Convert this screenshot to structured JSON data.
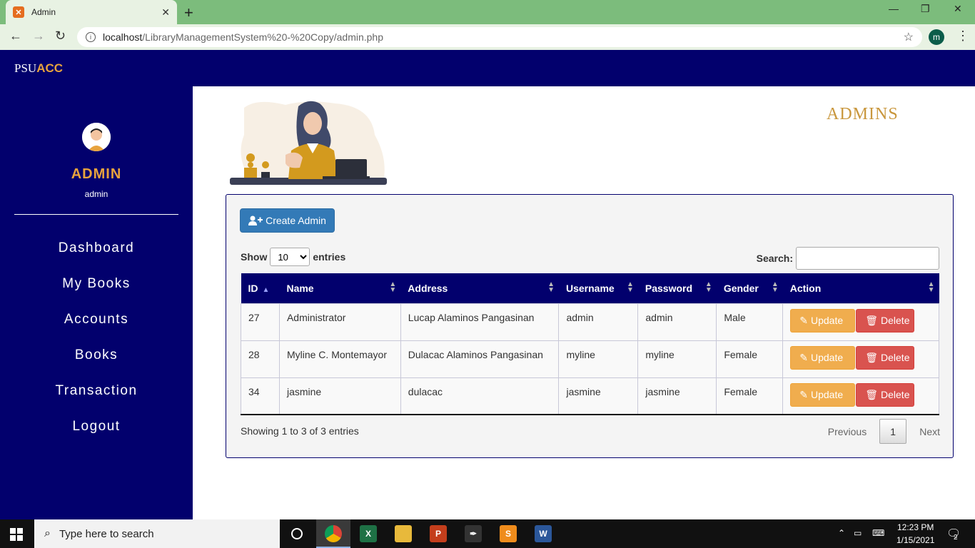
{
  "browser": {
    "tab_title": "Admin",
    "url_host": "localhost",
    "url_path": "/LibraryManagementSystem%20-%20Copy/admin.php",
    "profile_initial": "m"
  },
  "app": {
    "brand_psu": "PSU",
    "brand_acc": "ACC",
    "role": "ADMIN",
    "username": "admin",
    "nav": [
      "Dashboard",
      "My Books",
      "Accounts",
      "Books",
      "Transaction",
      "Logout"
    ],
    "heading": "ADMINS"
  },
  "panel": {
    "create_label": "Create Admin",
    "show_label": "Show",
    "entries_label": "entries",
    "page_size": "10",
    "search_label": "Search:",
    "columns": [
      "ID",
      "Name",
      "Address",
      "Username",
      "Password",
      "Gender",
      "Action"
    ],
    "rows": [
      [
        "27",
        "Administrator",
        "Lucap Alaminos Pangasinan",
        "admin",
        "admin",
        "Male"
      ],
      [
        "28",
        "Myline C. Montemayor",
        "Dulacac Alaminos Pangasinan",
        "myline",
        "myline",
        "Female"
      ],
      [
        "34",
        "jasmine",
        "dulacac",
        "jasmine",
        "jasmine",
        "Female"
      ]
    ],
    "update_label": "Update",
    "delete_label": "Delete",
    "info": "Showing 1 to 3 of 3 entries",
    "prev_label": "Previous",
    "current_page": "1",
    "next_label": "Next"
  },
  "taskbar": {
    "search_placeholder": "Type here to search",
    "time": "12:23 PM",
    "date": "1/15/2021",
    "notifications": "2"
  }
}
